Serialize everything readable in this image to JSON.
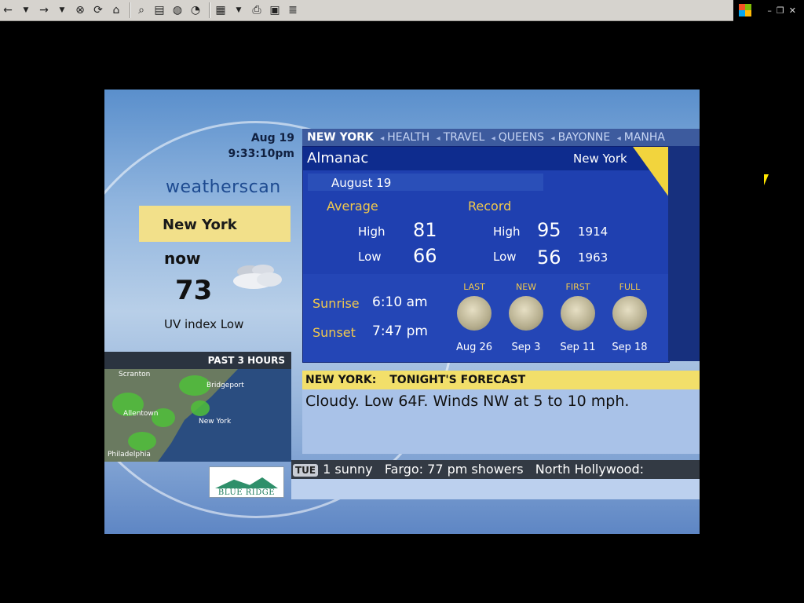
{
  "toolbar": {
    "buttons": [
      "back",
      "back-menu",
      "forward",
      "forward-menu",
      "stop",
      "refresh",
      "home",
      "search",
      "folder",
      "globe",
      "satellite",
      "page",
      "print",
      "monitor",
      "notes"
    ]
  },
  "weatherscan": {
    "date": "Aug 19",
    "time": "9:33:10pm",
    "brand": "weatherscan",
    "city": "New York",
    "now_label": "now",
    "temp": "73",
    "uv": "UV index Low",
    "radar_title": "PAST 3 HOURS",
    "map_labels": [
      "Scranton",
      "Bridgeport",
      "Allentown",
      "New York",
      "Philadelphia"
    ],
    "logo_text": "BLUE RIDGE"
  },
  "top_crawl": {
    "current": "NEW YORK",
    "items": [
      "HEALTH",
      "TRAVEL",
      "QUEENS",
      "BAYONNE",
      "MANHA"
    ],
    "separator": "◂"
  },
  "almanac": {
    "title": "Almanac",
    "city": "New York",
    "date": "August 19",
    "average_label": "Average",
    "record_label": "Record",
    "avg_high_label": "High",
    "avg_high": "81",
    "avg_low_label": "Low",
    "avg_low": "66",
    "rec_high_label": "High",
    "rec_high": "95",
    "rec_high_year": "1914",
    "rec_low_label": "Low",
    "rec_low": "56",
    "rec_low_year": "1963",
    "sunrise_label": "Sunrise",
    "sunrise": "6:10 am",
    "sunset_label": "Sunset",
    "sunset": "7:47 pm",
    "moons": [
      {
        "phase": "LAST",
        "date": "Aug 26"
      },
      {
        "phase": "NEW",
        "date": "Sep 3"
      },
      {
        "phase": "FIRST",
        "date": "Sep 11"
      },
      {
        "phase": "FULL",
        "date": "Sep 18"
      }
    ]
  },
  "forecast": {
    "city_label": "NEW YORK:",
    "title": "TONIGHT'S FORECAST",
    "text": "Cloudy. Low 64F. Winds NW at 5 to 10 mph."
  },
  "bottom_crawl": {
    "day": "TUE",
    "text": "1 sunny   Fargo: 77 pm showers   North Hollywood:"
  },
  "colors": {
    "panel_blue": "#1f40b0",
    "accent_yellow": "#f2c94c",
    "band_yellow": "#f2e08a"
  }
}
